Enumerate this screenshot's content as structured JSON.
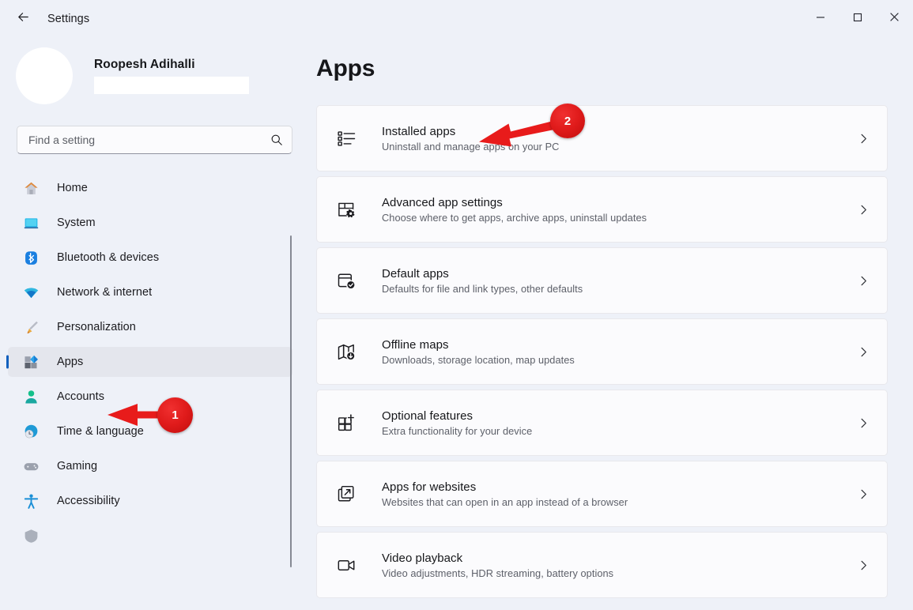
{
  "window": {
    "title": "Settings",
    "back_icon": "back-arrow-icon",
    "minimize_label": "─",
    "maximize_label": "☐",
    "close_label": "✕"
  },
  "profile": {
    "name": "Roopesh Adihalli",
    "email_redacted": ""
  },
  "search": {
    "placeholder": "Find a setting",
    "value": "",
    "icon": "search-icon"
  },
  "sidebar": {
    "items": [
      {
        "label": "Home",
        "icon": "home-icon",
        "selected": false
      },
      {
        "label": "System",
        "icon": "system-icon",
        "selected": false
      },
      {
        "label": "Bluetooth & devices",
        "icon": "bluetooth-icon",
        "selected": false
      },
      {
        "label": "Network & internet",
        "icon": "network-icon",
        "selected": false
      },
      {
        "label": "Personalization",
        "icon": "paintbrush-icon",
        "selected": false
      },
      {
        "label": "Apps",
        "icon": "apps-icon",
        "selected": true
      },
      {
        "label": "Accounts",
        "icon": "accounts-icon",
        "selected": false
      },
      {
        "label": "Time & language",
        "icon": "time-language-icon",
        "selected": false
      },
      {
        "label": "Gaming",
        "icon": "gaming-icon",
        "selected": false
      },
      {
        "label": "Accessibility",
        "icon": "accessibility-icon",
        "selected": false
      },
      {
        "label": "",
        "icon": "privacy-shield-icon",
        "selected": false
      }
    ]
  },
  "main": {
    "page_title": "Apps",
    "cards": [
      {
        "title": "Installed apps",
        "subtitle": "Uninstall and manage apps on your PC",
        "icon": "installed-apps-list-icon",
        "chevron": "chevron-right-icon"
      },
      {
        "title": "Advanced app settings",
        "subtitle": "Choose where to get apps, archive apps, uninstall updates",
        "icon": "advanced-app-settings-gear-icon",
        "chevron": "chevron-right-icon"
      },
      {
        "title": "Default apps",
        "subtitle": "Defaults for file and link types, other defaults",
        "icon": "default-apps-check-icon",
        "chevron": "chevron-right-icon"
      },
      {
        "title": "Offline maps",
        "subtitle": "Downloads, storage location, map updates",
        "icon": "offline-maps-download-icon",
        "chevron": "chevron-right-icon"
      },
      {
        "title": "Optional features",
        "subtitle": "Extra functionality for your device",
        "icon": "optional-features-plus-icon",
        "chevron": "chevron-right-icon"
      },
      {
        "title": "Apps for websites",
        "subtitle": "Websites that can open in an app instead of a browser",
        "icon": "apps-for-websites-external-icon",
        "chevron": "chevron-right-icon"
      },
      {
        "title": "Video playback",
        "subtitle": "Video adjustments, HDR streaming, battery options",
        "icon": "video-playback-camera-icon",
        "chevron": "chevron-right-icon"
      }
    ]
  },
  "annotations": [
    {
      "number": "1",
      "target": "sidebar-item-apps"
    },
    {
      "number": "2",
      "target": "card-installed-apps"
    }
  ],
  "colors": {
    "accent": "#0f5fbd",
    "annotation_red": "#e01b1b",
    "page_background": "#eef1f8",
    "card_background": "#fbfbfd"
  }
}
